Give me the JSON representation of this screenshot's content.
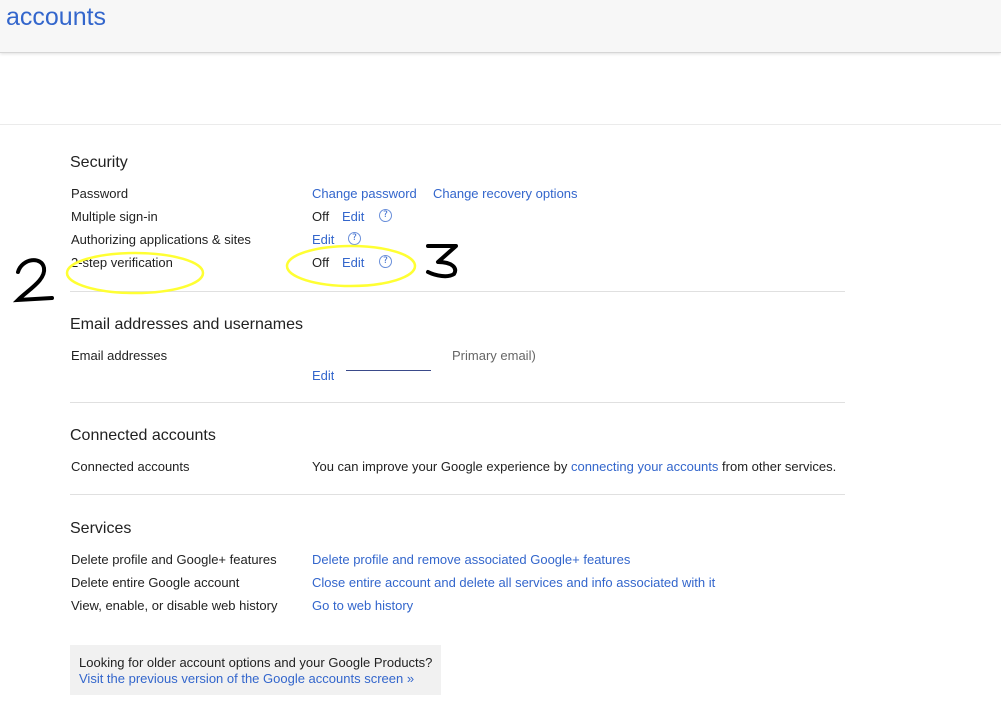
{
  "header": {
    "title": "accounts"
  },
  "security": {
    "title": "Security",
    "password": {
      "label": "Password",
      "change_password": "Change password",
      "change_recovery": "Change recovery options"
    },
    "multiple_signin": {
      "label": "Multiple sign-in",
      "status": "Off",
      "edit": "Edit",
      "help": "?"
    },
    "authorizing": {
      "label": "Authorizing applications & sites",
      "edit": "Edit",
      "help": "?"
    },
    "two_step": {
      "label": "2-step verification",
      "status": "Off",
      "edit": "Edit",
      "help": "?"
    }
  },
  "email": {
    "title": "Email addresses and usernames",
    "addresses_label": "Email addresses",
    "primary_note": "Primary email)",
    "edit": "Edit"
  },
  "connected": {
    "title": "Connected accounts",
    "label": "Connected accounts",
    "text_before": "You can improve your Google experience by",
    "link": "connecting your accounts",
    "text_after": "from other services."
  },
  "services": {
    "title": "Services",
    "rows": [
      {
        "label": "Delete profile and Google+ features",
        "action": "Delete profile and remove associated Google+ features"
      },
      {
        "label": "Delete entire Google account",
        "action": "Close entire account and delete all services and info associated with it"
      },
      {
        "label": "View, enable, or disable web history",
        "action": "Go to web history"
      }
    ]
  },
  "promo": {
    "question": "Looking for older account options and your Google Products?",
    "link": "Visit the previous version of the Google accounts screen »"
  },
  "annotations": {
    "mark_2": "2",
    "mark_3": "3",
    "highlight_color": "#ffff33"
  },
  "colors": {
    "link": "#3366cc",
    "brand_title": "#3366cc",
    "text": "#222222"
  }
}
